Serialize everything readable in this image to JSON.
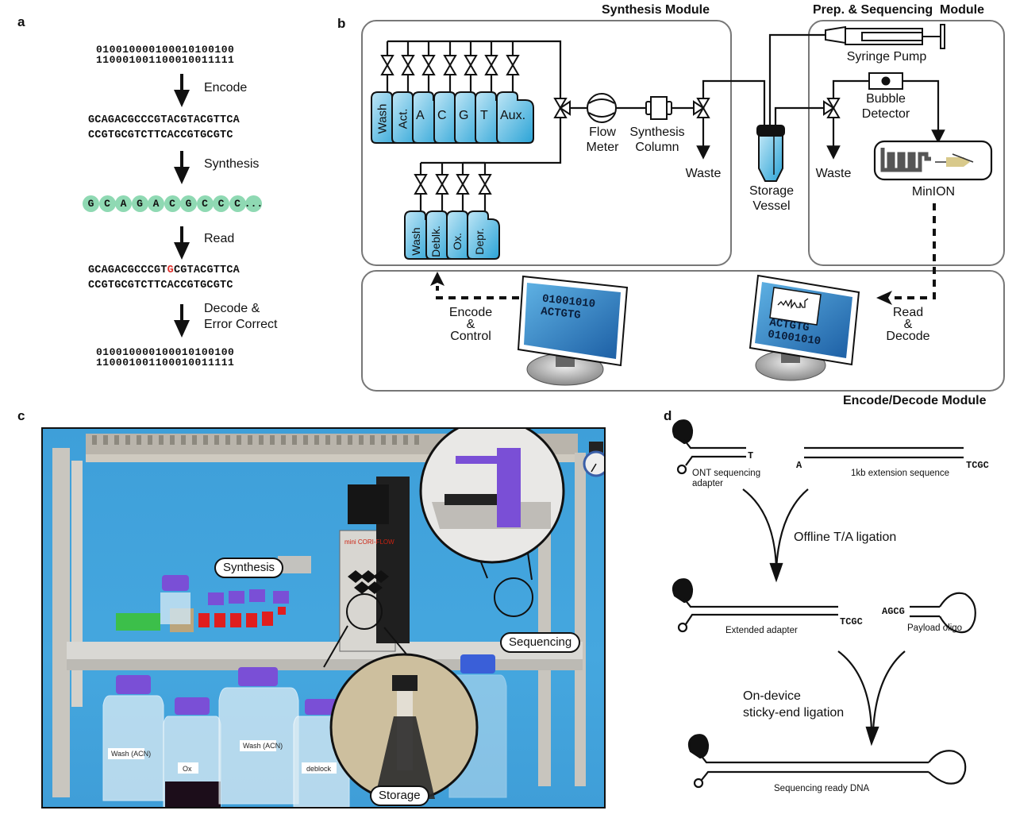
{
  "panels": {
    "a": "a",
    "b": "b",
    "c": "c",
    "d": "d"
  },
  "panel_a": {
    "input_binary": [
      "010010000100010100100",
      "110001001100010011111"
    ],
    "steps": [
      "Encode",
      "Synthesis",
      "Read",
      "Decode & Error Correct"
    ],
    "decode_label_lines": [
      "Decode &",
      "Error Correct"
    ],
    "encoded_seq": [
      "GCAGACGCCCGTACGTACGTTCA",
      "CCGTGCGTCTTCACCGTGCGTC"
    ],
    "synth_beads": [
      "G",
      "C",
      "A",
      "G",
      "A",
      "C",
      "G",
      "C",
      "C",
      "C",
      "..."
    ],
    "read_seq_line1": {
      "before": "GCAGACGCCCGT",
      "error": "G",
      "after": "CGTACGTTCA"
    },
    "read_seq_line2": "CCGTGCGTCTTCACCGTGCGTC",
    "output_binary": [
      "010010000100010100100",
      "110001001100010011111"
    ],
    "error_color": "#e0302b",
    "bead_color": "#8fd9b3"
  },
  "panel_b": {
    "modules": {
      "synthesis": "Synthesis Module",
      "prep": "Prep. & Sequencing  Module",
      "encode_decode": "Encode/Decode Module"
    },
    "top_reagents": [
      "Wash",
      "Act.",
      "A",
      "C",
      "G",
      "T",
      "Aux."
    ],
    "bottom_reagents": [
      "Wash",
      "Deblk.",
      "Ox.",
      "Depr."
    ],
    "components": {
      "flow_meter": [
        "Flow",
        "Meter"
      ],
      "synthesis_column": [
        "Synthesis",
        "Column"
      ],
      "waste": "Waste",
      "storage_vessel": [
        "Storage",
        "Vessel"
      ],
      "syringe_pump": "Syringe Pump",
      "bubble_detector": [
        "Bubble",
        "Detector"
      ],
      "waste2": "Waste",
      "minion": "MinION"
    },
    "encode_control": [
      "Encode",
      "&",
      "Control"
    ],
    "read_decode": [
      "Read",
      "&",
      "Decode"
    ],
    "monitor_left": [
      "01001010",
      "ACTGTG"
    ],
    "monitor_right": [
      "ACTGTG",
      "01001010"
    ],
    "reagent_color": "#3fb0dc",
    "screen_color": "#2a74b8"
  },
  "panel_c": {
    "callouts": {
      "synthesis": "Synthesis",
      "sequencing": "Sequencing",
      "storage": "Storage"
    },
    "bottle_labels": [
      "Wash (ACN)",
      "Ox",
      "Wash (ACN)",
      "deblock"
    ],
    "device_label": "mini CORI-FLOW",
    "background_color": "#42a3dc",
    "cap_color": "#7a4fd6"
  },
  "panel_d": {
    "adapter_overhang": "T",
    "adapter_label": [
      "ONT sequencing",
      "adapter"
    ],
    "extension_left": "A",
    "extension_right": "TCGC",
    "extension_label": "1kb extension sequence",
    "step1": "Offline T/A ligation",
    "extended_label": "Extended adapter",
    "extended_overhang": "TCGC",
    "payload_overhang": "AGCG",
    "payload_label": "Payload oligo",
    "step2": [
      "On-device",
      "sticky-end ligation"
    ],
    "final_label": "Sequencing ready DNA"
  }
}
